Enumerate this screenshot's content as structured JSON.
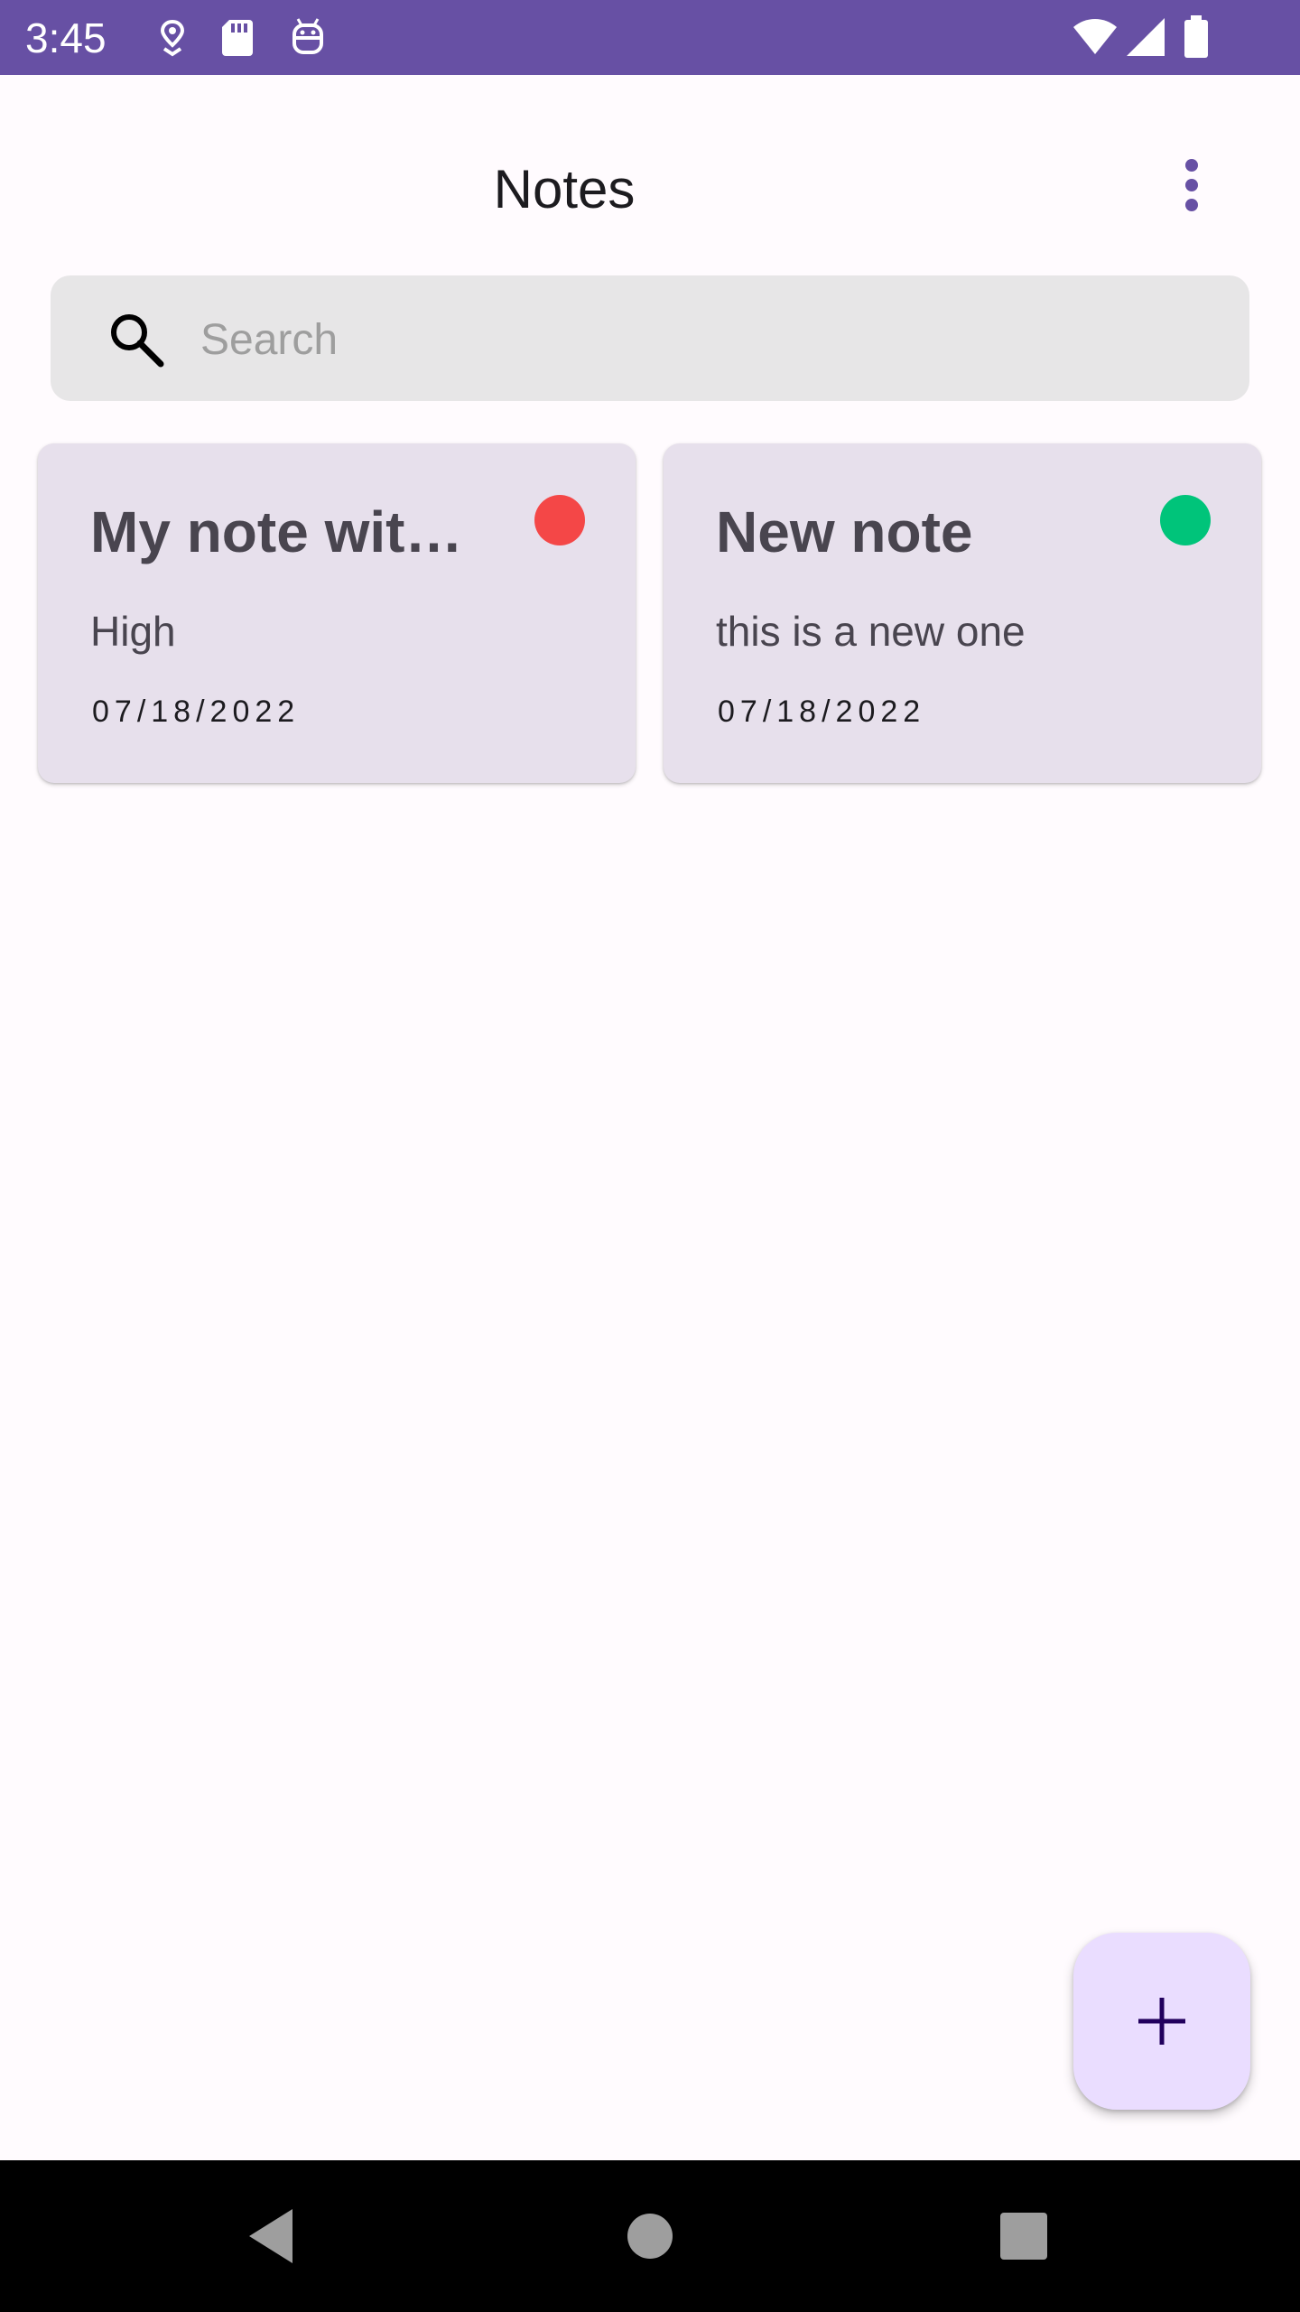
{
  "status_bar": {
    "time": "3:45",
    "background_color": "#6750a4",
    "left_icons": [
      "location-drop-icon",
      "sd-card-icon",
      "robot-icon"
    ],
    "right_icons": [
      "wifi-icon",
      "cell-signal-icon",
      "battery-icon"
    ]
  },
  "app_bar": {
    "title": "Notes",
    "menu_icon": "more-vert-icon"
  },
  "search": {
    "placeholder": "Search",
    "value": "",
    "icon": "search-icon"
  },
  "notes": [
    {
      "title": "My note wit…",
      "body": "High",
      "date": "07/18/2022",
      "priority_color": "#f44747"
    },
    {
      "title": "New note",
      "body": "this is a new one",
      "date": "07/18/2022",
      "priority_color": "#00c47a"
    }
  ],
  "fab": {
    "icon": "add-icon",
    "background_color": "#eaddff"
  },
  "nav_bar": {
    "buttons": [
      "back-icon",
      "home-icon",
      "recents-icon"
    ]
  }
}
